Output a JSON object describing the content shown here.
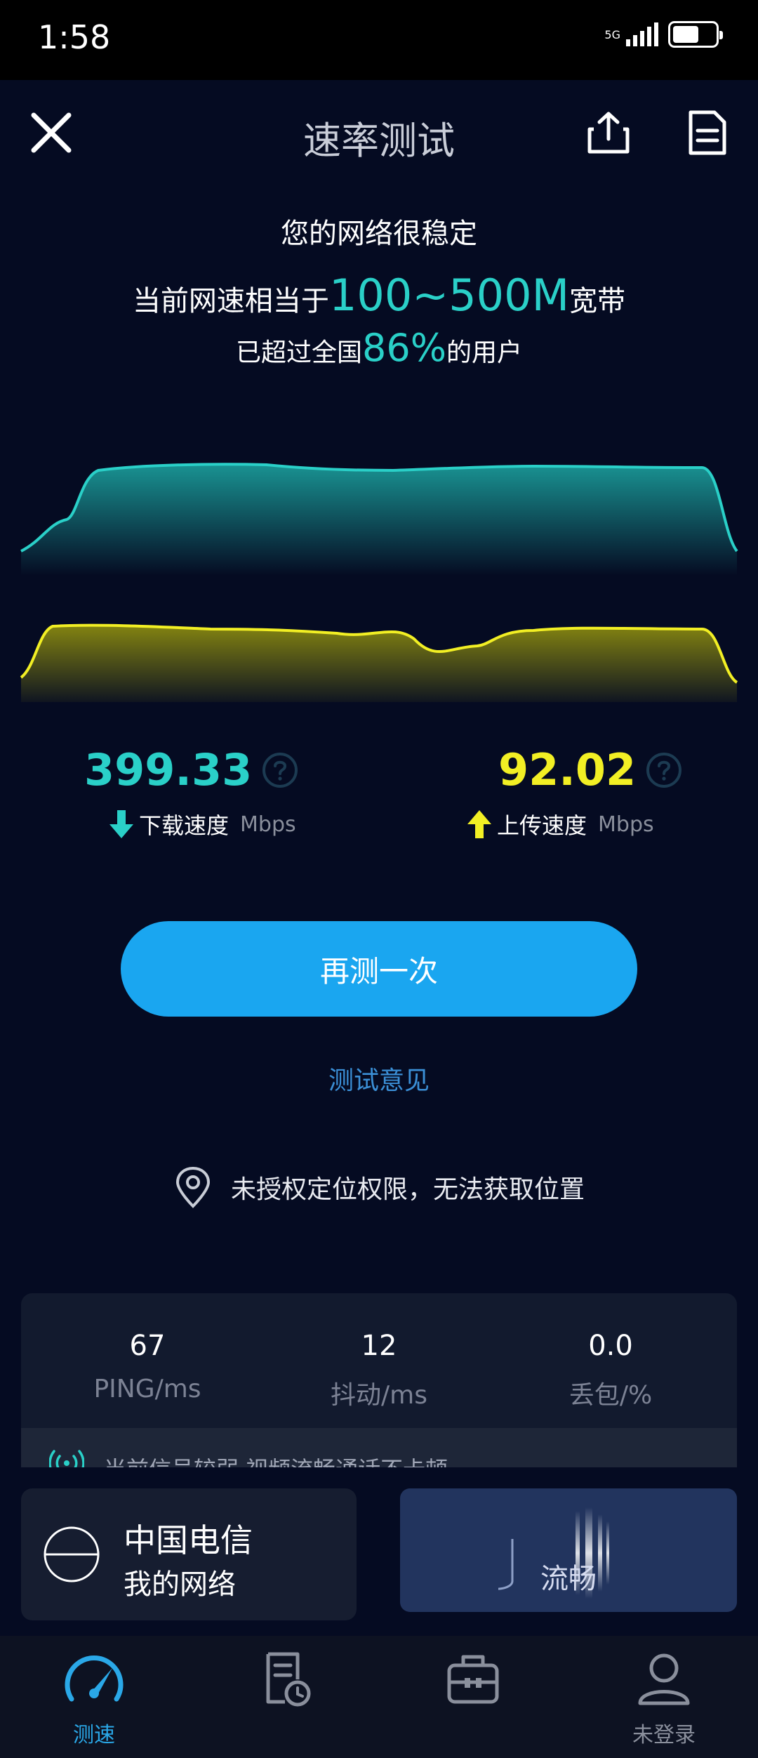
{
  "status_bar": {
    "time": "1:58",
    "network_type": "5G",
    "battery_level": 0.6
  },
  "header": {
    "title": "速率测试"
  },
  "summary": {
    "stable": "您的网络很稳定",
    "equiv_prefix": "当前网速相当于",
    "equiv_value": "100~500M",
    "equiv_suffix": "宽带",
    "exceed_prefix": "已超过全国",
    "exceed_value": "86%",
    "exceed_suffix": "的用户"
  },
  "download": {
    "value": "399.33",
    "label": "下载速度",
    "unit": "Mbps"
  },
  "upload": {
    "value": "92.02",
    "label": "上传速度",
    "unit": "Mbps"
  },
  "actions": {
    "retest": "再测一次",
    "feedback": "测试意见"
  },
  "location": {
    "text": "未授权定位权限，无法获取位置"
  },
  "stats": [
    {
      "value": "67",
      "label": "PING/ms"
    },
    {
      "value": "12",
      "label": "抖动/ms"
    },
    {
      "value": "0.0",
      "label": "丢包/%"
    }
  ],
  "signal_notice": "当前信号较弱 视频流畅通话不卡顿",
  "isp": {
    "name": "中国电信",
    "sub": "我的网络"
  },
  "quality": {
    "label": "流畅"
  },
  "nav": [
    {
      "label": "测速",
      "active": true
    },
    {
      "label": "",
      "active": false
    },
    {
      "label": "",
      "active": false
    },
    {
      "label": "未登录",
      "active": false
    }
  ],
  "colors": {
    "background": "#050b22",
    "download": "#2ad0c8",
    "upload": "#f2ef24",
    "accent_button": "#1aa6f0",
    "link": "#3b8fd6"
  }
}
